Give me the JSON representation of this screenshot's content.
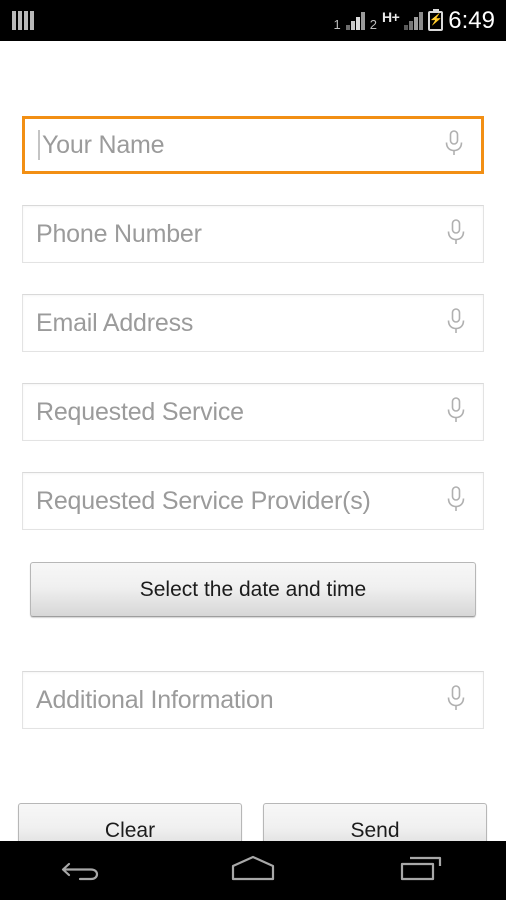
{
  "status_bar": {
    "notification_icon": "sim-bars-icon",
    "sim1_label": "1",
    "sim2_label": "2",
    "network_type": "H+",
    "battery_icon": "battery-charging-icon",
    "clock": "6:49",
    "background_color": "#000000",
    "text_color": "#ffffff"
  },
  "form": {
    "accent_color": "#f28f14",
    "placeholder_color": "#9b9b9b",
    "fields": [
      {
        "name": "your-name",
        "placeholder": "Your Name",
        "value": "",
        "focused": true,
        "voice_icon": "microphone-icon"
      },
      {
        "name": "phone-number",
        "placeholder": "Phone Number",
        "value": "",
        "focused": false,
        "voice_icon": "microphone-icon"
      },
      {
        "name": "email-address",
        "placeholder": "Email Address",
        "value": "",
        "focused": false,
        "voice_icon": "microphone-icon"
      },
      {
        "name": "requested-service",
        "placeholder": "Requested Service",
        "value": "",
        "focused": false,
        "voice_icon": "microphone-icon"
      },
      {
        "name": "requested-service-provider",
        "placeholder": "Requested Service Provider(s)",
        "value": "",
        "focused": false,
        "voice_icon": "microphone-icon"
      },
      {
        "name": "additional-information",
        "placeholder": "Additional Information",
        "value": "",
        "focused": false,
        "voice_icon": "microphone-icon"
      }
    ],
    "buttons": {
      "datetime_label": "Select the date and time",
      "clear_label": "Clear",
      "send_label": "Send"
    }
  },
  "nav_bar": {
    "back_icon": "back-arrow-icon",
    "home_icon": "home-icon",
    "recents_icon": "recent-apps-icon",
    "background_color": "#000000"
  }
}
